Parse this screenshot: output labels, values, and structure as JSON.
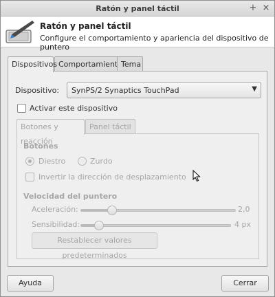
{
  "window": {
    "title": "Ratón y panel táctil",
    "maximize_glyph": "+",
    "close_glyph": "×"
  },
  "header": {
    "title": "Ratón y panel táctil",
    "subtitle": "Configure el comportamiento y apariencia del dispositivo de puntero",
    "icon": "mouse-settings-icon"
  },
  "tabs": [
    {
      "label": "Dispositivos",
      "active": true
    },
    {
      "label": "Comportamiento",
      "active": false
    },
    {
      "label": "Tema",
      "active": false
    }
  ],
  "device": {
    "label": "Dispositivo:",
    "value": "SynPS/2 Synaptics TouchPad",
    "arrow": "▼"
  },
  "enable_device": {
    "label": "Activar este dispositivo",
    "checked": false
  },
  "inner_tabs": [
    {
      "label": "Botones y reacción",
      "active": true
    },
    {
      "label": "Panel táctil",
      "active": false
    }
  ],
  "buttons_section": {
    "heading": "Botones",
    "right_handed": "Diestro",
    "left_handed": "Zurdo",
    "invert_scroll": "Invertir la dirección de desplazamiento"
  },
  "pointer_speed": {
    "heading": "Velocidad del puntero",
    "acceleration_label": "Aceleración:",
    "acceleration_value": "2,0",
    "acceleration_level": 0.2,
    "sensitivity_label": "Sensibilidad:",
    "sensitivity_value": "4 px",
    "sensitivity_level": 0.12,
    "reset_label": "Restablecer valores predeterminados"
  },
  "footer": {
    "help_label": "Ayuda",
    "close_label": "Cerrar"
  }
}
